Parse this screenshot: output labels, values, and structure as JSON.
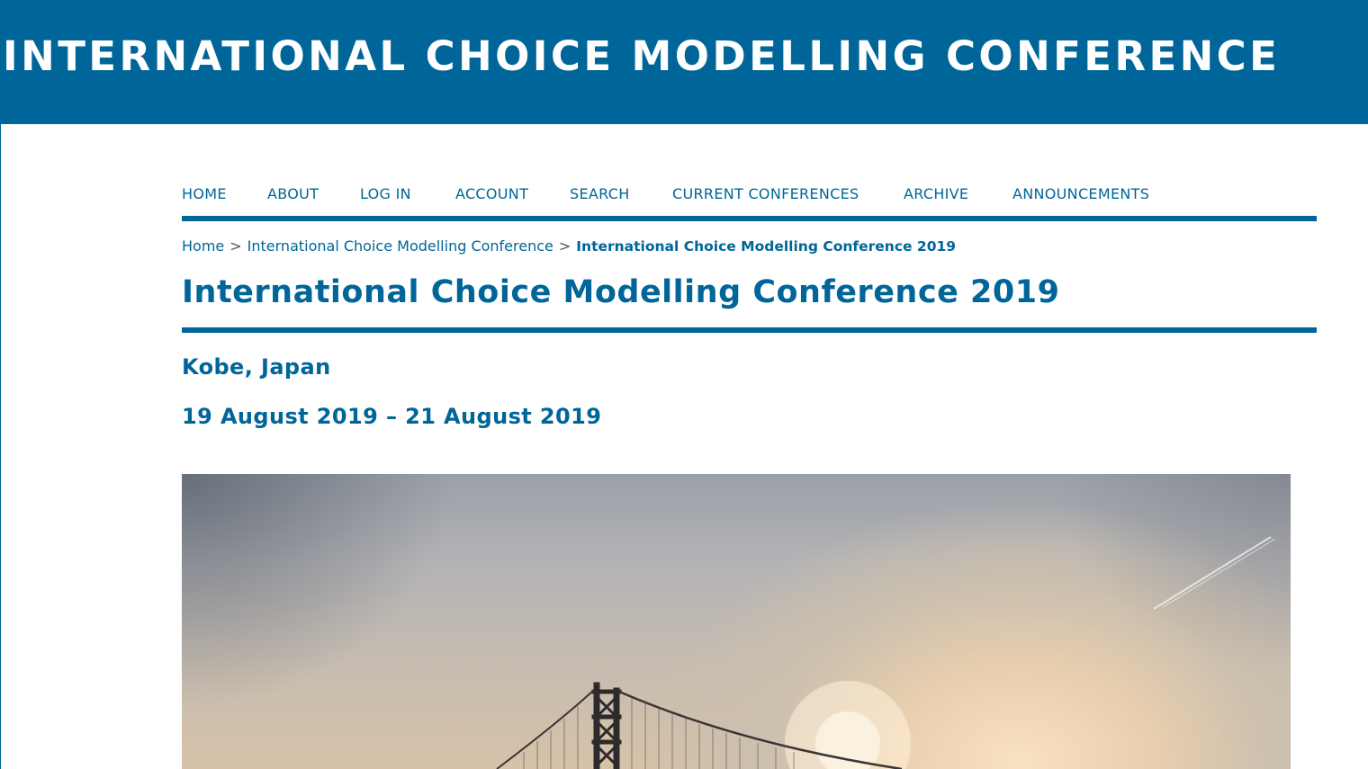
{
  "site": {
    "banner_title": "INTERNATIONAL CHOICE MODELLING CONFERENCE"
  },
  "nav": {
    "items": [
      {
        "label": "HOME"
      },
      {
        "label": "ABOUT"
      },
      {
        "label": "LOG IN"
      },
      {
        "label": "ACCOUNT"
      },
      {
        "label": "SEARCH"
      },
      {
        "label": "CURRENT CONFERENCES"
      },
      {
        "label": "ARCHIVE"
      },
      {
        "label": "ANNOUNCEMENTS"
      }
    ]
  },
  "breadcrumb": {
    "home": "Home",
    "separator": ">",
    "parent": "International Choice Modelling Conference",
    "current": "International Choice Modelling Conference 2019"
  },
  "conference": {
    "title": "International Choice Modelling Conference 2019",
    "location": "Kobe, Japan",
    "dates": "19 August 2019 – 21 August 2019"
  },
  "hero": {
    "icon": "bridge-sunset-photo"
  },
  "colors": {
    "brand": "#006699",
    "background": "#ffffff",
    "banner_text": "#ffffff"
  }
}
